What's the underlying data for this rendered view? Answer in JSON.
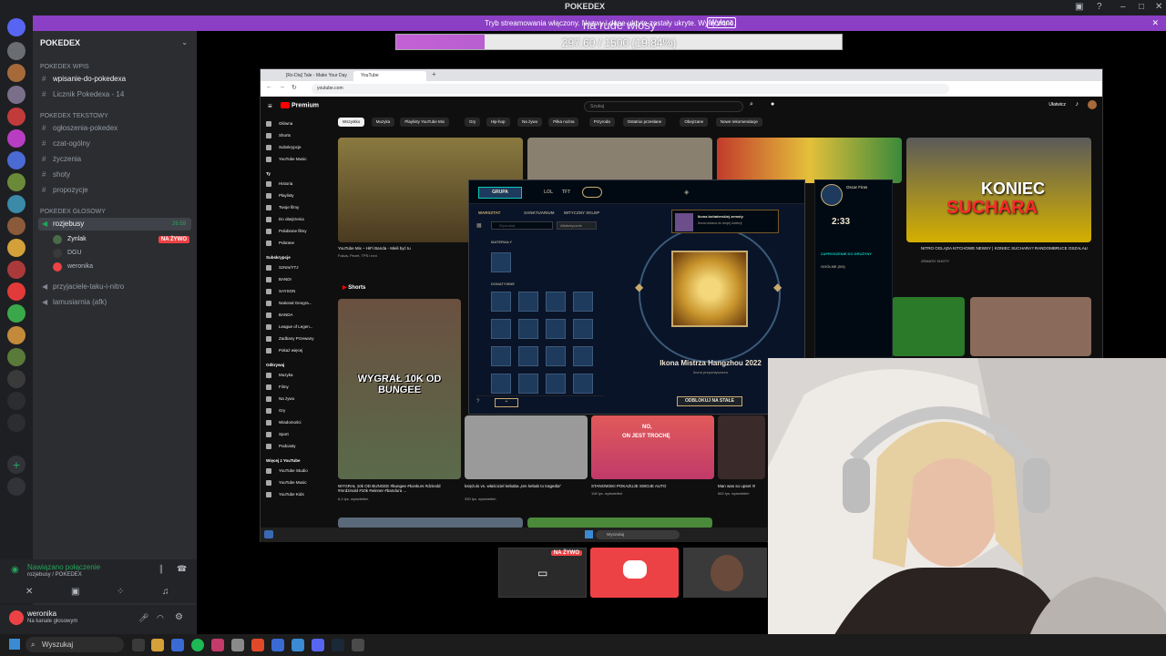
{
  "window": {
    "title": "POKEDEX"
  },
  "banner": {
    "text": "Tryb streamowania włączony. Nazwy i dane ukryte zostały ukryte. Wyłączono.",
    "button": "Wyłącz"
  },
  "goal": {
    "title": "na rude włosy",
    "text": "297.60 / 1500 (19.84%)",
    "progress_percent": 19.84
  },
  "server": {
    "name": "POKEDEX"
  },
  "categories": {
    "wpis": "POKEDEX Wpis",
    "text": "POKEDEX Tekstowy",
    "voice": "POKEDEX GŁOSOWY"
  },
  "channels": {
    "wpis": [
      "wpisanie-do-pokedexa",
      "Licznik Pokedexa - 14"
    ],
    "text": [
      "ogłoszenia-pokedex",
      "czat-ogólny",
      "życzenia",
      "shoty",
      "propozycje"
    ],
    "voice_active": {
      "name": "rozjebusy",
      "time": "26:59"
    },
    "voice_users": [
      {
        "name": "Zynlak",
        "live": "NA ŻYWO"
      },
      {
        "name": "DGU"
      },
      {
        "name": "weronika"
      }
    ],
    "other_voice": [
      "przyjaciele-taku-i-nitro",
      "lamusiarnia (afk)"
    ]
  },
  "voice_panel": {
    "status": "Nawiązano połączenie",
    "sub": "rozjebusy / POKEDEX"
  },
  "user": {
    "name": "weronika",
    "status": "Na kanale głosowym"
  },
  "browser": {
    "tabs": [
      "[Rx-Dia] Tale - Make Your Day",
      "YouTube"
    ],
    "url": "youtube.com"
  },
  "youtube": {
    "logo": "Premium",
    "search_placeholder": "Szukaj",
    "login": "Ułatwicz",
    "chips": [
      "Wszystko",
      "Muzyka",
      "Playlisty YouTube Mix",
      "Gry",
      "Hip-hop",
      "Na żywo",
      "Piłka nożna",
      "Przyroda",
      "Ostatnio przesłane",
      "Obejrzane",
      "Nowe rekomendacje"
    ],
    "side_main": [
      "Główna",
      "Shorts",
      "Subskrypcje",
      "YouTube Music"
    ],
    "side_you_head": "Ty",
    "side_you": [
      "Historia",
      "Playlisty",
      "Twoje filmy",
      "Do obejrzenia",
      "Polubione filmy",
      "Pobrane"
    ],
    "side_subs_head": "Subskrypcje",
    "side_subs": [
      "SzNrs/YTJ",
      "BANDI",
      "SAYSON",
      "National Geogra...",
      "BANDA",
      "League of Legen...",
      "Zadbany Przewany",
      "Pokaż więcej"
    ],
    "side_explore_head": "Odkrywaj",
    "side_explore": [
      "Muzyka",
      "Filmy",
      "Na żywo",
      "Gry",
      "Wiadomości",
      "Sport",
      "Podcasty"
    ],
    "side_more_head": "Więcej z YouTube",
    "side_more": [
      "YouTube Studio",
      "YouTube Music",
      "YouTube Kids"
    ],
    "videos": [
      {
        "title": "YouTube Mix – HiFi Banda - Mieli być tu",
        "sub": "Fokus, Pezet, TPS i inni"
      },
      {
        "title": "NITRO OGLĄDA KITCHOWE NEWSY | KONIEC SUCHARA? RANDOMBRUCE OSZALAŁ!",
        "sub": "ZEMATO SHOTY"
      },
      {
        "title": "WYGRAŁ 10k OD BUNGEE #bungee #konkurs #dzinold #mrdzinold #10k #winner #bandura ...",
        "sub": "6,4 tys. wyświetleń"
      },
      {
        "title": "księżulo vs. właściciel kebaba „ten kebab to tragedia”",
        "sub": "330 tys. wyświetleń"
      },
      {
        "title": "STANOWSKI POKAZUJE SWOJE AUTO",
        "sub": "118 tys. wyświetleń"
      },
      {
        "title": "Man was so upset !!!",
        "sub": "662 tys. wyświetleń"
      }
    ],
    "shorts_head": "Shorts",
    "thumb_texts": {
      "koniec": "KONIEC",
      "suchara": "SUCHARA",
      "wygral": "WYGRAŁ 10K OD BUNGEE",
      "no": "NO,",
      "jest": "ON JEST TROCHĘ"
    }
  },
  "lol": {
    "group": "GRUPA",
    "nav": [
      "LOL",
      "TFT"
    ],
    "tabs": [
      "WARSZTAT",
      "SANKTUARIUM",
      "MITYCZNY SKLEP"
    ],
    "search": "Wyszukaj",
    "sort": "Alfabetycznie",
    "section1": "MATERIAŁY",
    "section2": "DONATYWNE",
    "prize_name": "Ikona Mistrza Hangzhou 2022",
    "prize_sub": "Ikona przywoływacza",
    "unlock": "ODBLOKUJ NA STAŁE",
    "popup_title": "Ikona bohaterskiej zemsty",
    "popup_sub": "Ikona dodana do twojej kolekcji",
    "social_name": "Oscar Firas",
    "timer": "2:33",
    "social_sec1": "ZAPROSZENIE DO DRUŻYNY",
    "social_sec2": "OGÓLNE (0/3)"
  },
  "inner_taskbar": {
    "search": "Wyszukaj"
  },
  "tile_live": "NA ŻYWO",
  "taskbar": {
    "search": "Wyszukaj"
  },
  "colors": {
    "discord_bg": "#1e1f22",
    "accent": "#8a3fc4",
    "live": "#ed4245"
  }
}
